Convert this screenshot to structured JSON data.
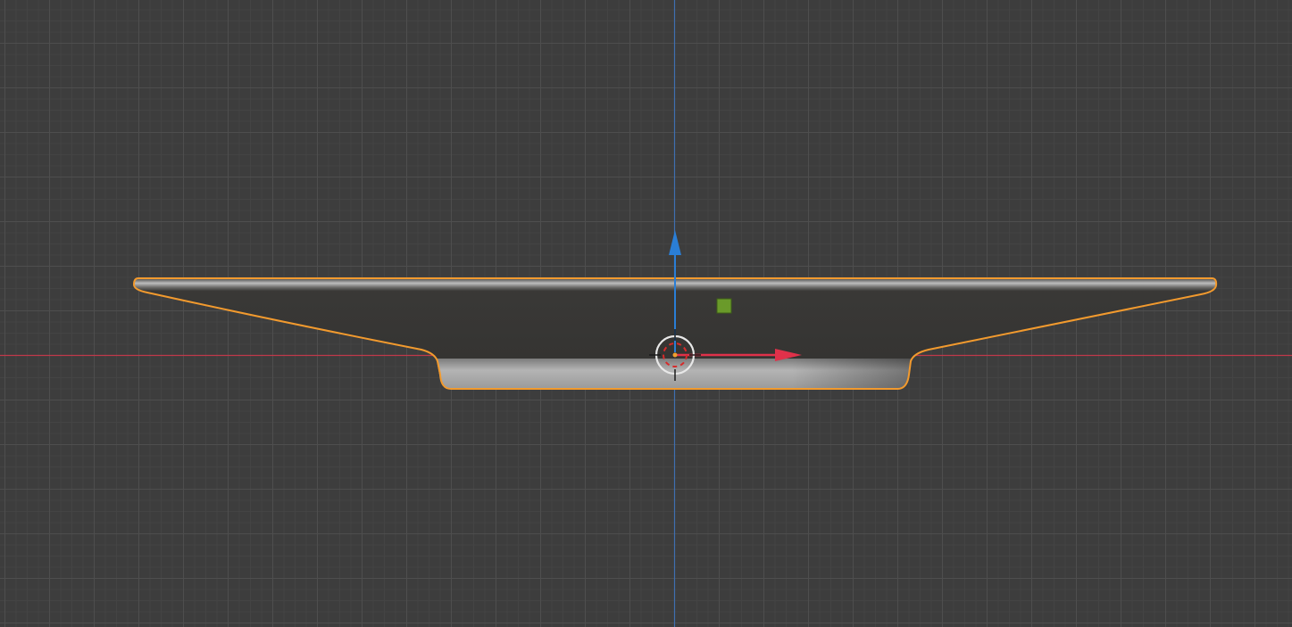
{
  "viewport": {
    "background_color": "#3d3d3d",
    "minor_grid_color": "#444444",
    "major_grid_color": "#4e4e4e",
    "x_axis_color": "#c0394b",
    "z_axis_color": "#3f6fb0"
  },
  "selected_object": {
    "shape": "saucer / plate profile (side view)",
    "outline_color": "#f29a2e",
    "body_color_dark": "#3a3937",
    "body_color_light": "#a8a8a8",
    "origin_marker_color": "#6a9a2a"
  },
  "gizmo": {
    "x_arrow_color": "#e0314a",
    "z_arrow_color": "#2a7ed6"
  },
  "cursor_3d": {
    "ring_color_white": "#e8e8e8",
    "ring_color_red": "#d62a2a",
    "center_color": "#f0a030"
  }
}
